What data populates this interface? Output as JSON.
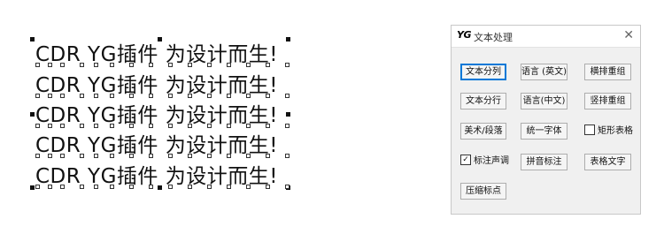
{
  "canvas": {
    "lines": [
      "CDR YG插件 为设计而生!",
      "CDR YG插件 为设计而生!",
      "CDR YG插件 为设计而生!",
      "CDR YG插件 为设计而生!",
      "CDR YG插件 为设计而生!"
    ]
  },
  "panel": {
    "logo": "YG",
    "title": "文本处理",
    "close": "✕",
    "buttons": {
      "text_split_column": "文本分列",
      "language_en": "语言 (英文)",
      "horizontal_regroup": "横排重组",
      "text_split_row": "文本分行",
      "language_zh": "语言(中文)",
      "vertical_regroup": "竖排重组",
      "art_paragraph": "美术/段落",
      "unify_font": "统一字体",
      "pinyin_annotate": "拼音标注",
      "table_text": "表格文字",
      "compress_punct": "压缩标点"
    },
    "checkboxes": {
      "rect_table": {
        "label": "矩形表格",
        "checked": false
      },
      "mark_tone": {
        "label": "标注声调",
        "checked": true
      }
    }
  },
  "colors": {
    "focus_border": "#0078d7",
    "panel_bg": "#f0f0f0"
  }
}
